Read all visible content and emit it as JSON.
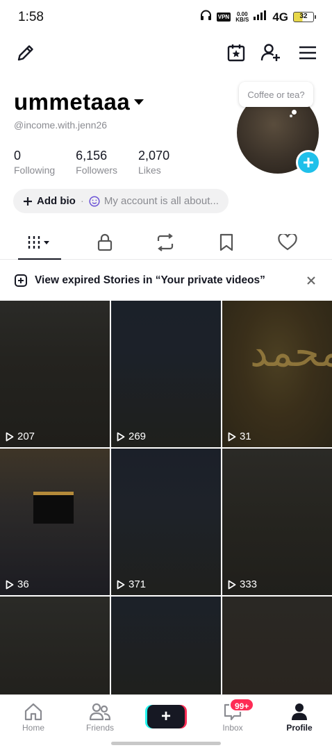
{
  "status_bar": {
    "time": "1:58",
    "vpn": "VPN",
    "net_speed_value": "0.00",
    "net_speed_unit": "KB/S",
    "network": "4G",
    "battery": "32"
  },
  "profile": {
    "username": "ummetaaa",
    "handle": "@income.with.jenn26",
    "stats": [
      {
        "value": "0",
        "label": "Following"
      },
      {
        "value": "6,156",
        "label": "Followers"
      },
      {
        "value": "2,070",
        "label": "Likes"
      }
    ],
    "add_bio_label": "Add bio",
    "bio_separator": "·",
    "bio_placeholder": "My account is all about...",
    "note_bubble": "Coffee or tea?"
  },
  "notice": {
    "text": "View expired Stories in “Your private videos”"
  },
  "videos": [
    {
      "views": "207"
    },
    {
      "views": "269"
    },
    {
      "views": "31"
    },
    {
      "views": "36"
    },
    {
      "views": "371"
    },
    {
      "views": "333"
    },
    {
      "views": ""
    },
    {
      "views": ""
    },
    {
      "views": ""
    }
  ],
  "bottom_nav": {
    "home": "Home",
    "friends": "Friends",
    "create": "+",
    "inbox": "Inbox",
    "inbox_badge": "99+",
    "profile": "Profile"
  },
  "colors": {
    "accent_blue": "#20c0ea",
    "badge_red": "#fe2c55",
    "text_primary": "#161823",
    "text_secondary": "#8a8b91"
  }
}
